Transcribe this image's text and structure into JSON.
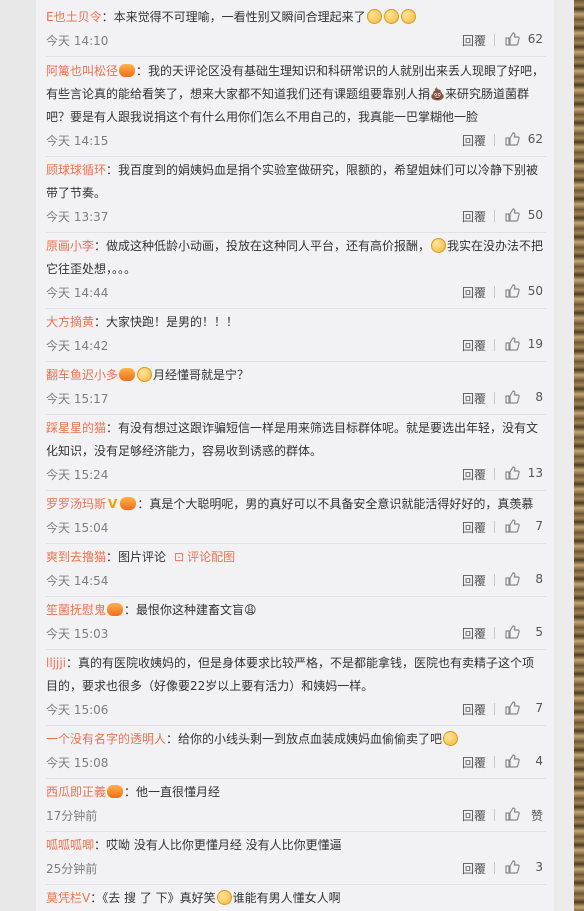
{
  "comments": [
    {
      "user": "E也土贝令",
      "text": "：本来觉得不可理喻，一看性别又瞬间合理起来了",
      "time": "今天 14:10",
      "likes": "62",
      "emojis": 3
    },
    {
      "user": "阿篱也叫松径",
      "text": "：我的天评论区没有基础生理知识和科研常识的人就别出来丢人现眼了好吧，有些言论真的能给看笑了，想来大家都不知道我们还有课题组要靠别人捐💩来研究肠道菌群吧？要是有人跟我说捐这个有什么用你们怎么不用自己的，我真能一巴掌糊他一脸",
      "time": "今天 14:15",
      "likes": "62",
      "badge": true
    },
    {
      "user": "顾球球循环",
      "text": "：我百度到的娟姨妈血是捐个实验室做研究，限额的，希望姐妹们可以冷静下别被带了节奏。",
      "time": "今天 13:37",
      "likes": "50"
    },
    {
      "user": "原画小李",
      "text": "：做成这种低龄小动画，投放在这种同人平台，还有高价报酬，",
      "text2": "我实在没办法不把它往歪处想，。。。",
      "time": "今天 14:44",
      "likes": "50"
    },
    {
      "user": "大方摘黄",
      "text": "：大家快跑！是男的！！！",
      "time": "今天 14:42",
      "likes": "19"
    },
    {
      "user": "翻车鱼迟小多",
      "text": "月经懂哥就是宁？",
      "time": "今天 15:17",
      "likes": "8",
      "badge": true
    },
    {
      "user": "踩星星的猫",
      "text": "：有没有想过这跟诈骗短信一样是用来筛选目标群体呢。就是要选出年轻，没有文化知识，没有足够经济能力，容易收到诱惑的群体。",
      "time": "今天 15:24",
      "likes": "13"
    },
    {
      "user": "罗罗汤玛斯",
      "text": "：真是个大聪明呢，男的真好可以不具备安全意识就能活得好好的，真羡慕",
      "time": "今天 15:04",
      "likes": "7",
      "badge": true,
      "vip": "V"
    },
    {
      "user": "爽到去撸猫",
      "text": "：图片评论",
      "extra": "评论配图",
      "time": "今天 14:54",
      "likes": "8"
    },
    {
      "user": "笙菌抚慰鬼",
      "text": "：最恨你这种建畜文盲😩",
      "time": "今天 15:03",
      "likes": "5",
      "badge": true
    },
    {
      "user": "lljjji",
      "text": "：真的有医院收姨妈的，但是身体要求比较严格，不是都能拿钱，医院也有卖精子这个项目的，要求也很多（好像要22岁以上要有活力）和姨妈一样。",
      "time": "今天 15:06",
      "likes": "7"
    },
    {
      "user": "一个没有名字的透明人",
      "text": "：给你的小线头剩一到放点血装成姨妈血偷偷卖了吧",
      "time": "今天 15:08",
      "likes": "4"
    },
    {
      "user": "西瓜即正義",
      "text": "：他一直很懂月经",
      "time": "17分钟前",
      "likes": "赞",
      "badge": true
    },
    {
      "user": "呱呱呱唧",
      "text": "：哎呦 没有人比你更懂月经 没有人比你更懂逼",
      "time": "25分钟前",
      "likes": "3"
    },
    {
      "user": "莫凭栏V",
      "text": "：《去 搜 了 下》真好笑",
      "text2": "谁能有男人懂女人啊",
      "time": "",
      "likes": ""
    }
  ],
  "labels": {
    "reply": "回覆"
  }
}
